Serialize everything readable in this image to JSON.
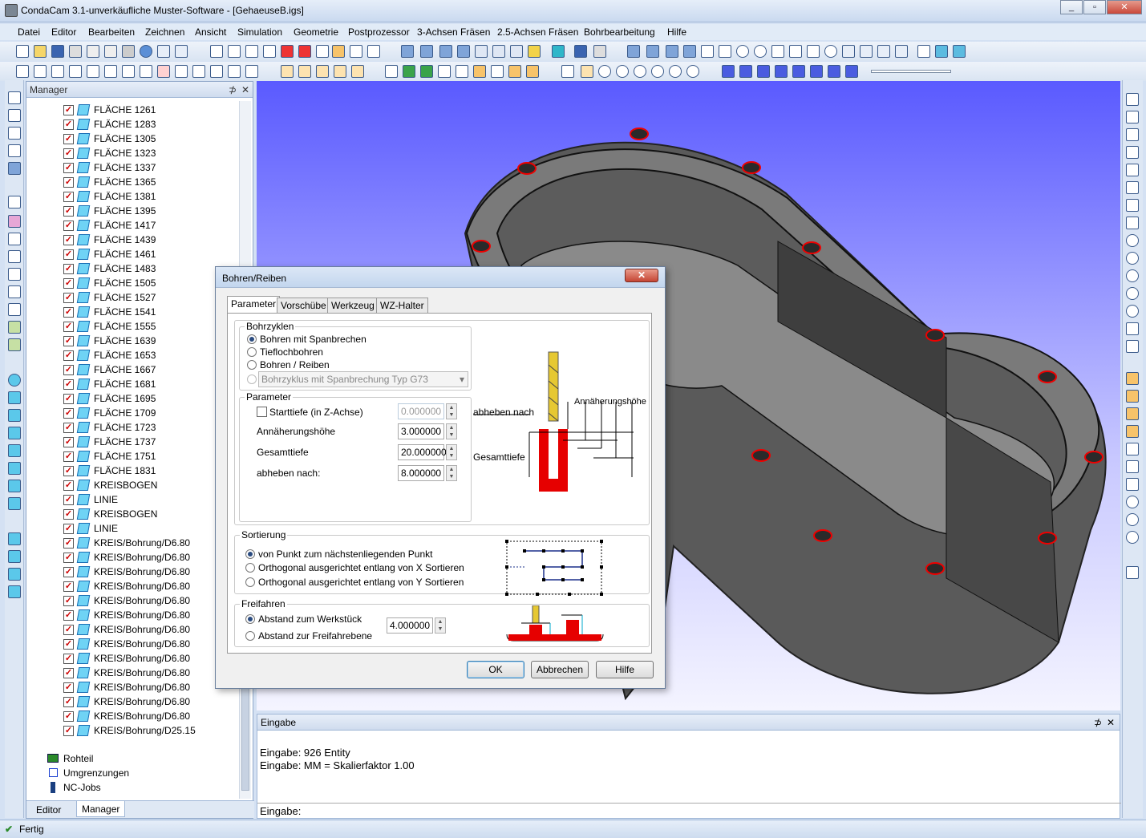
{
  "window": {
    "title": "CondaCam 3.1-unverkäufliche Muster-Software - [GehaeuseB.igs]",
    "controls": {
      "minimize": "_",
      "restore": "▫",
      "close": "✕"
    }
  },
  "menu": [
    "Datei",
    "Editor",
    "Bearbeiten",
    "Zeichnen",
    "Ansicht",
    "Simulation",
    "Geometrie",
    "Postprozessor",
    "3-Achsen Fräsen",
    "2.5-Achsen Fräsen",
    "Bohrbearbeitung",
    "Hilfe"
  ],
  "manager": {
    "title": "Manager",
    "pin": "⊅",
    "close": "✕",
    "items": [
      "FLÄCHE 1261",
      "FLÄCHE 1283",
      "FLÄCHE 1305",
      "FLÄCHE 1323",
      "FLÄCHE 1337",
      "FLÄCHE 1365",
      "FLÄCHE 1381",
      "FLÄCHE 1395",
      "FLÄCHE 1417",
      "FLÄCHE 1439",
      "FLÄCHE 1461",
      "FLÄCHE 1483",
      "FLÄCHE 1505",
      "FLÄCHE 1527",
      "FLÄCHE 1541",
      "FLÄCHE 1555",
      "FLÄCHE 1639",
      "FLÄCHE 1653",
      "FLÄCHE 1667",
      "FLÄCHE 1681",
      "FLÄCHE 1695",
      "FLÄCHE 1709",
      "FLÄCHE 1723",
      "FLÄCHE 1737",
      "FLÄCHE 1751",
      "FLÄCHE 1831",
      "KREISBOGEN",
      "LINIE",
      "KREISBOGEN",
      "LINIE",
      "KREIS/Bohrung/D6.80",
      "KREIS/Bohrung/D6.80",
      "KREIS/Bohrung/D6.80",
      "KREIS/Bohrung/D6.80",
      "KREIS/Bohrung/D6.80",
      "KREIS/Bohrung/D6.80",
      "KREIS/Bohrung/D6.80",
      "KREIS/Bohrung/D6.80",
      "KREIS/Bohrung/D6.80",
      "KREIS/Bohrung/D6.80",
      "KREIS/Bohrung/D6.80",
      "KREIS/Bohrung/D6.80",
      "KREIS/Bohrung/D6.80",
      "KREIS/Bohrung/D25.15"
    ],
    "roots": [
      "Rohteil",
      "Umgrenzungen",
      "NC-Jobs"
    ],
    "tabs": [
      "Editor",
      "Manager"
    ]
  },
  "dialog": {
    "title": "Bohren/Reiben",
    "close": "✕",
    "tabs": [
      "Parameter",
      "Vorschübe",
      "Werkzeug",
      "WZ-Halter"
    ],
    "bohrzyklen": {
      "label": "Bohrzyklen",
      "options": [
        "Bohren mit Spanbrechen",
        "Tieflochbohren",
        "Bohren / Reiben"
      ],
      "selected": 0,
      "combo": "Bohrzyklus mit Spanbrechung  Typ G73"
    },
    "parameter": {
      "label": "Parameter",
      "starttiefe_label": "Starttiefe (in Z-Achse)",
      "starttiefe": "0.000000",
      "annaeherung_label": "Annäherungshöhe",
      "annaeherung": "3.000000",
      "gesamttiefe_label": "Gesamttiefe",
      "gesamttiefe": "20.000000",
      "abheben_label": "abheben nach:",
      "abheben": "8.000000"
    },
    "diagram": {
      "abheben": "abheben nach",
      "annaeherung": "Annäherungshöhe",
      "gesamttiefe": "Gesamttiefe"
    },
    "sortierung": {
      "label": "Sortierung",
      "options": [
        "von Punkt zum nächstenliegenden Punkt",
        "Orthogonal ausgerichtet entlang von X Sortieren",
        "Orthogonal ausgerichtet entlang von Y Sortieren"
      ],
      "selected": 0
    },
    "freifahren": {
      "label": "Freifahren",
      "options": [
        "Abstand zum Werkstück",
        "Abstand zur Freifahrebene"
      ],
      "selected": 0,
      "value": "4.000000"
    },
    "buttons": {
      "ok": "OK",
      "cancel": "Abbrechen",
      "help": "Hilfe"
    }
  },
  "eingabe": {
    "title": "Eingabe",
    "lines": [
      "Eingabe: 926 Entity",
      "Eingabe: MM = Skalierfaktor 1.00"
    ],
    "prompt": "Eingabe:"
  },
  "status": {
    "text": "Fertig"
  },
  "colors": {
    "viewport_top": "#5a5aff",
    "part": "#6e6e6e",
    "hole": "#cc0000"
  }
}
